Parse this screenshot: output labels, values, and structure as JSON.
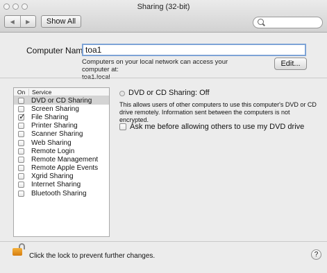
{
  "window": {
    "title": "Sharing (32-bit)"
  },
  "toolbar": {
    "show_all": "Show All",
    "search_placeholder": ""
  },
  "computer_name": {
    "label": "Computer Name:",
    "value": "toa1",
    "help_line1": "Computers on your local network can access your computer at:",
    "help_line2": "toa1.local",
    "edit_label": "Edit..."
  },
  "services": {
    "header_on": "On",
    "header_service": "Service",
    "items": [
      {
        "label": "DVD or CD Sharing",
        "checked": false,
        "selected": true
      },
      {
        "label": "Screen Sharing",
        "checked": false
      },
      {
        "label": "File Sharing",
        "checked": true
      },
      {
        "label": "Printer Sharing",
        "checked": false
      },
      {
        "label": "Scanner Sharing",
        "checked": false
      },
      {
        "label": "Web Sharing",
        "checked": false
      },
      {
        "label": "Remote Login",
        "checked": false
      },
      {
        "label": "Remote Management",
        "checked": false
      },
      {
        "label": "Remote Apple Events",
        "checked": false
      },
      {
        "label": "Xgrid Sharing",
        "checked": false
      },
      {
        "label": "Internet Sharing",
        "checked": false
      },
      {
        "label": "Bluetooth Sharing",
        "checked": false
      }
    ]
  },
  "detail": {
    "status": "DVD or CD Sharing: Off",
    "description": "This allows users of other computers to use this computer's DVD or CD drive remotely. Information sent between the computers is not encrypted.",
    "ask_label": "Ask me before allowing others to use my DVD drive"
  },
  "footer": {
    "lock_text": "Click the lock to prevent further changes.",
    "help_label": "?"
  }
}
